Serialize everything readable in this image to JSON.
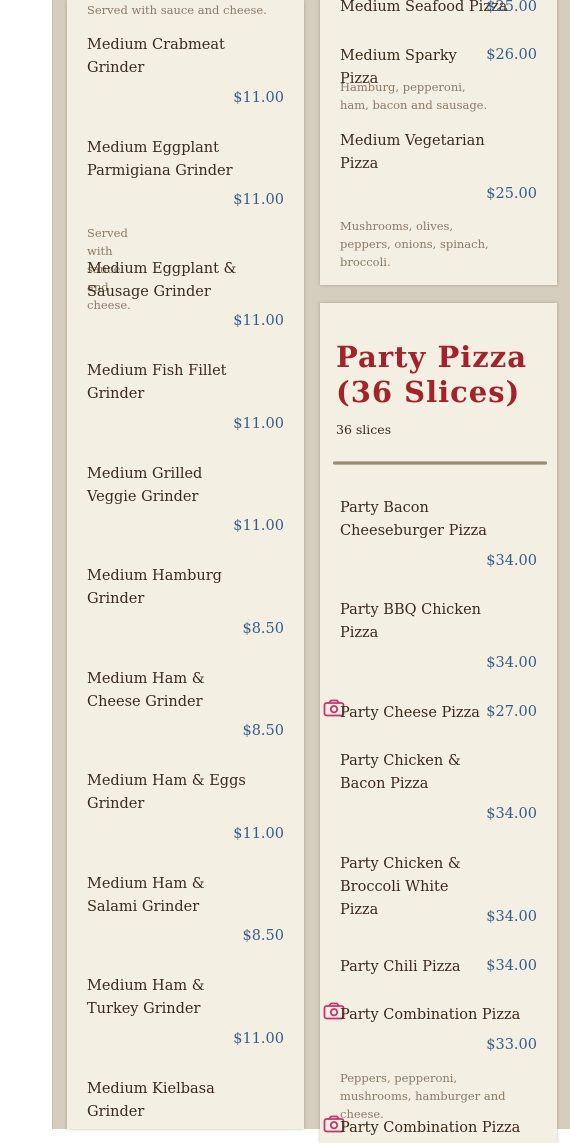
{
  "left": {
    "top_desc": "Served with sauce and cheese.",
    "items": [
      {
        "name": "Medium Crabmeat Grinder",
        "price": "$11.00"
      },
      {
        "name": "Medium Eggplant Parmigiana Grinder",
        "price": "$11.00",
        "desc": "Served with sauce and cheese."
      },
      {
        "name": "Medium Eggplant & Sausage Grinder",
        "price": "$11.00"
      },
      {
        "name": "Medium Fish Fillet Grinder",
        "price": "$11.00"
      },
      {
        "name": "Medium Grilled Veggie Grinder",
        "price": "$11.00"
      },
      {
        "name": "Medium Hamburg Grinder",
        "price": "$8.50"
      },
      {
        "name": "Medium Ham & Cheese Grinder",
        "price": "$8.50"
      },
      {
        "name": "Medium Ham & Eggs Grinder",
        "price": "$11.00"
      },
      {
        "name": "Medium Ham & Salami Grinder",
        "price": "$8.50"
      },
      {
        "name": "Medium Ham & Turkey Grinder",
        "price": "$11.00"
      },
      {
        "name": "Medium Kielbasa Grinder",
        "price": ""
      }
    ]
  },
  "right_top": {
    "items": [
      {
        "name": "Medium Seafood Pizza",
        "price": "$25.00"
      },
      {
        "name": "Medium Sparky Pizza",
        "price": "$26.00",
        "desc": "Hamburg, pepperoni, ham, bacon and sausage."
      },
      {
        "name": "Medium Vegetarian Pizza",
        "price": "$25.00",
        "desc": "Mushrooms, olives, peppers, onions, spinach, broccoli."
      }
    ]
  },
  "party": {
    "title": "Party Pizza (36 Slices)",
    "subtitle": "36 slices",
    "items": [
      {
        "name": "Party Bacon Cheeseburger Pizza",
        "price": "$34.00"
      },
      {
        "name": "Party BBQ Chicken Pizza",
        "price": "$34.00"
      },
      {
        "name": "Party Cheese Pizza",
        "price": "$27.00",
        "has_photo": true
      },
      {
        "name": "Party Chicken & Bacon Pizza",
        "price": "$34.00"
      },
      {
        "name": "Party Chicken & Broccoli White Pizza",
        "price": "$34.00"
      },
      {
        "name": "Party Chili Pizza",
        "price": "$34.00"
      },
      {
        "name": "Party Combination Pizza",
        "price": "$33.00",
        "has_photo": true,
        "desc": "Peppers, pepperoni, mushrooms, hamburger and cheese."
      },
      {
        "name": "Party Combination Pizza",
        "price": "",
        "has_photo": true
      }
    ]
  },
  "colors": {
    "title_red": "#a4232a",
    "price_blue": "#3a5b8a",
    "icon_pink": "#c8336b"
  }
}
